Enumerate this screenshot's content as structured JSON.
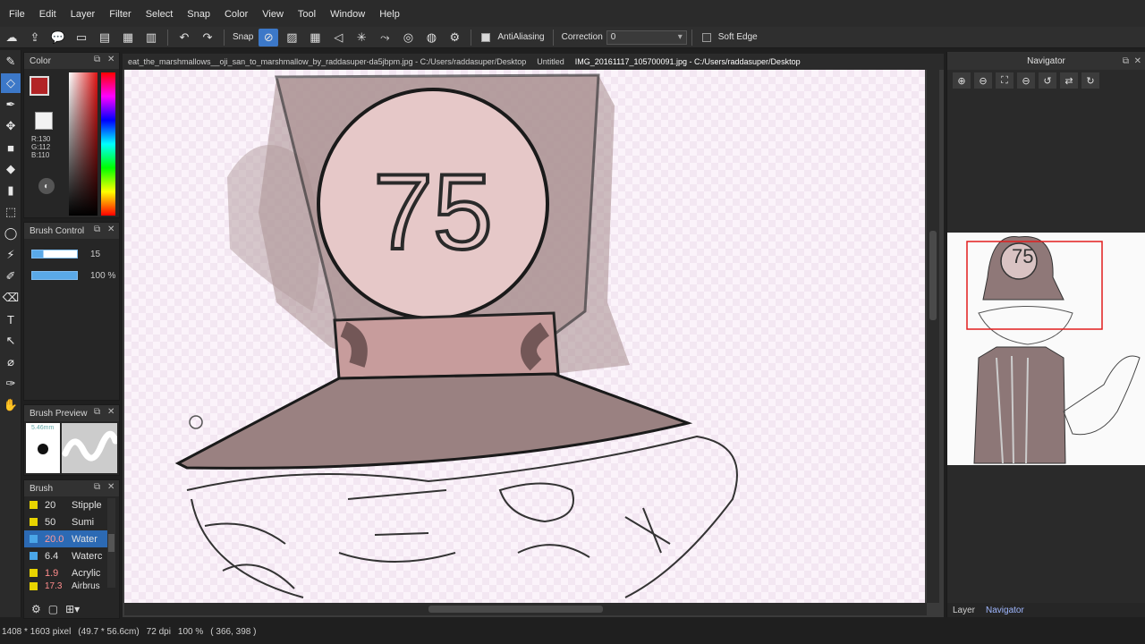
{
  "menu": [
    "File",
    "Edit",
    "Layer",
    "Filter",
    "Select",
    "Snap",
    "Color",
    "View",
    "Tool",
    "Window",
    "Help"
  ],
  "toolbar": {
    "snap_label": "Snap",
    "antialiasing_label": "AntiAliasing",
    "correction_label": "Correction",
    "correction_value": "0",
    "softedge_label": "Soft Edge"
  },
  "tabs": [
    {
      "label": "eat_the_marshmallows__oji_san_to_marshmallow_by_raddasuper-da5jbpm.jpg - C:/Users/raddasuper/Desktop"
    },
    {
      "label": "Untitled"
    },
    {
      "label": "IMG_20161117_105700091.jpg - C:/Users/raddasuper/Desktop"
    }
  ],
  "color_panel": {
    "title": "Color",
    "r": "R:130",
    "g": "G:112",
    "b": "B:110",
    "fg_color": "#b22426",
    "bg_color": "#f2f2f2"
  },
  "brush_control": {
    "title": "Brush Control",
    "size_value": "15",
    "opacity_value": "100 %"
  },
  "brush_preview": {
    "title": "Brush Preview",
    "size_text": "5.46mm"
  },
  "brush_panel": {
    "title": "Brush",
    "items": [
      {
        "size": "20",
        "name": "Stipple",
        "color": "yellow"
      },
      {
        "size": "50",
        "name": "Sumi",
        "color": "yellow"
      },
      {
        "size": "20.0",
        "name": "Water",
        "color": "blue",
        "selected": true
      },
      {
        "size": "6.4",
        "name": "Waterc",
        "color": "blue"
      },
      {
        "size": "1.9",
        "name": "Acrylic",
        "color": "yellow"
      },
      {
        "size": "17.3",
        "name": "Airbrus",
        "color": "yellow"
      }
    ]
  },
  "navigator": {
    "title": "Navigator",
    "thumb_number": "75"
  },
  "nav_tabs": [
    "Layer",
    "Navigator"
  ],
  "canvas": {
    "helmet_number": "75"
  },
  "status": {
    "size": "1408 * 1603 pixel",
    "cm": "(49.7 * 56.6cm)",
    "dpi": "72 dpi",
    "zoom": "100 %",
    "coords": "( 366, 398 )"
  },
  "accent_color": "#3c78c8"
}
